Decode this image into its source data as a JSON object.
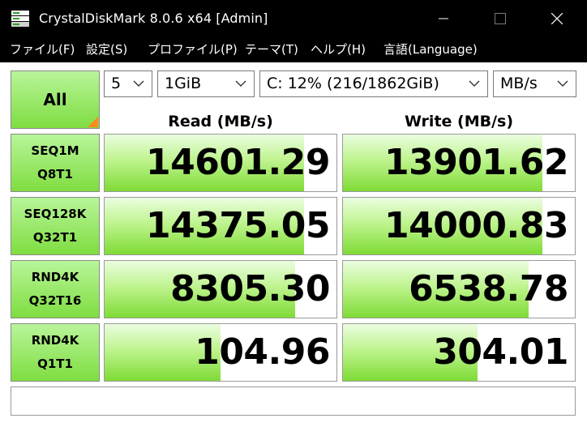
{
  "window": {
    "title": "CrystalDiskMark 8.0.6 x64 [Admin]",
    "app_icon": "disk-icon",
    "controls": [
      "minimize-icon",
      "maximize-icon",
      "close-icon"
    ]
  },
  "menu": [
    {
      "label": "ファイル(F)"
    },
    {
      "label": "設定(S)"
    },
    {
      "label": "プロファイル(P)"
    },
    {
      "label": "テーマ(T)"
    },
    {
      "label": "ヘルプ(H)"
    },
    {
      "label": "言語(Language)"
    }
  ],
  "controls": {
    "all_label": "All",
    "count": "5",
    "size": "1GiB",
    "drive": "C: 12% (216/1862GiB)",
    "unit": "MB/s"
  },
  "headers": {
    "read": "Read (MB/s)",
    "write": "Write (MB/s)"
  },
  "tests": [
    {
      "line1": "SEQ1M",
      "line2": "Q8T1",
      "read": "14601.29",
      "write": "13901.62",
      "read_bar": 0.86,
      "write_bar": 0.86
    },
    {
      "line1": "SEQ128K",
      "line2": "Q32T1",
      "read": "14375.05",
      "write": "14000.83",
      "read_bar": 0.86,
      "write_bar": 0.86
    },
    {
      "line1": "RND4K",
      "line2": "Q32T16",
      "read": "8305.30",
      "write": "6538.78",
      "read_bar": 0.82,
      "write_bar": 0.8
    },
    {
      "line1": "RND4K",
      "line2": "Q1T1",
      "read": "104.96",
      "write": "304.01",
      "read_bar": 0.5,
      "write_bar": 0.58
    }
  ],
  "comment": "",
  "colors": {
    "titlebar": "#000000",
    "bar_green": "#7edb35",
    "label_green": "#8ee04f",
    "corner_orange": "#ff8a1f"
  }
}
